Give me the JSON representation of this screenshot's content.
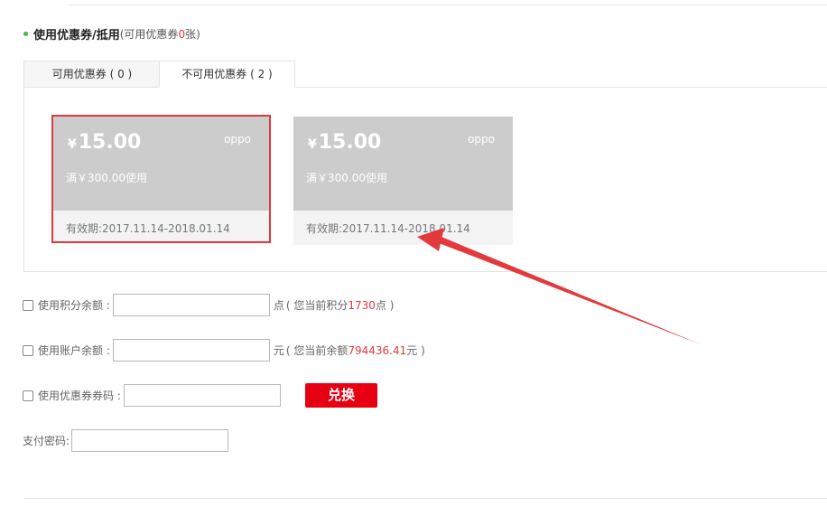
{
  "section": {
    "title": "使用优惠券/抵用",
    "subtitle_prefix": "(可用优惠券",
    "subtitle_count": "0",
    "subtitle_suffix": "张)"
  },
  "tabs": [
    {
      "label": "可用优惠券 ( 0 )"
    },
    {
      "label": "不可用优惠券 ( 2 )"
    }
  ],
  "coupons": [
    {
      "currency": "¥",
      "amount": "15.00",
      "brand": "oppo",
      "condition": "满￥300.00使用",
      "validity": "有效期:2017.11.14-2018.01.14"
    },
    {
      "currency": "¥",
      "amount": "15.00",
      "brand": "oppo",
      "condition": "满￥300.00使用",
      "validity": "有效期:2017.11.14-2018.01.14"
    }
  ],
  "points": {
    "label": "使用积分余额 :",
    "unit": "点",
    "hint_prefix": "( 您当前积分",
    "hint_value": "1730",
    "hint_suffix": "点 )"
  },
  "balance": {
    "label": "使用账户余额 :",
    "unit": "元",
    "hint_prefix": "( 您当前余额",
    "hint_value": "794436.41",
    "hint_suffix": "元 )"
  },
  "coupon_code": {
    "label": "使用优惠券券码 :",
    "button": "兑换"
  },
  "password": {
    "label": "支付密码:"
  },
  "colors": {
    "accent_red": "#e4393c",
    "button_red": "#e60012",
    "coupon_gray": "#cccccc",
    "dot_green": "#4caf50"
  }
}
